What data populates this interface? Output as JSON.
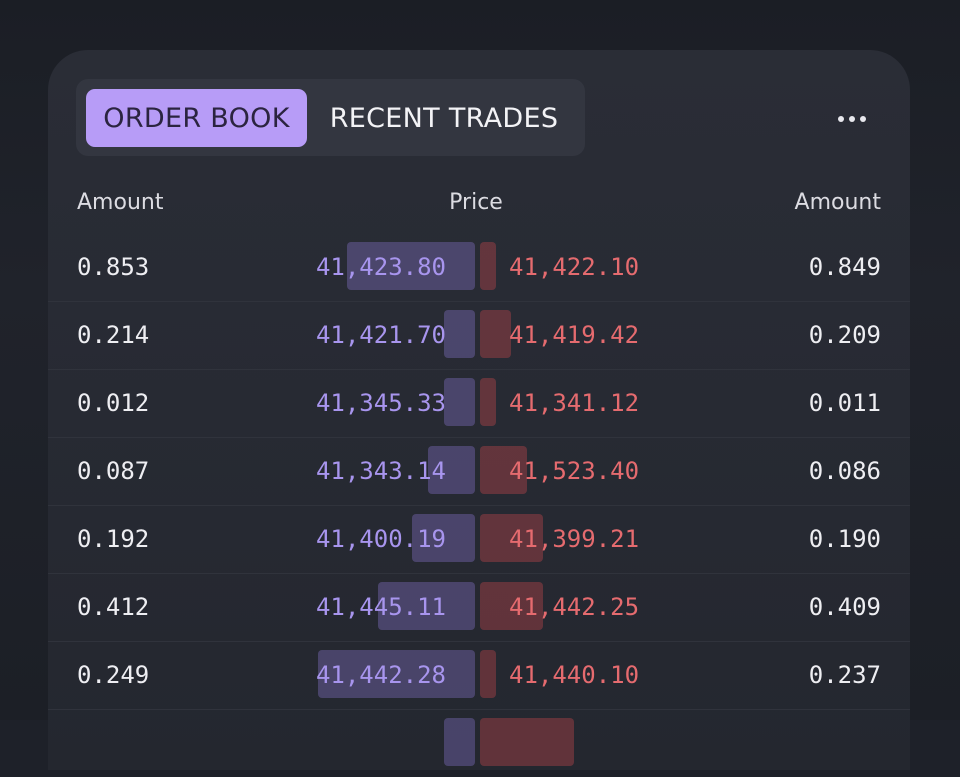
{
  "tabs": {
    "order_book": "ORDER BOOK",
    "recent_trades": "RECENT TRADES"
  },
  "headers": {
    "left": "Amount",
    "mid": "Price",
    "right": "Amount"
  },
  "colors": {
    "accent": "#b79cf7",
    "bid": "#a895ee",
    "ask": "#e56b6f",
    "background": "#1e2129",
    "card": "#2a2d36"
  },
  "rows": [
    {
      "bid_amount": "0.853",
      "bid_price": "41,423.80",
      "ask_price": "41,422.10",
      "ask_amount": "0.849",
      "bid_depth": 0.49,
      "ask_depth": 0.06
    },
    {
      "bid_amount": "0.214",
      "bid_price": "41,421.70",
      "ask_price": "41,419.42",
      "ask_amount": "0.209",
      "bid_depth": 0.12,
      "ask_depth": 0.12
    },
    {
      "bid_amount": "0.012",
      "bid_price": "41,345.33",
      "ask_price": "41,341.12",
      "ask_amount": "0.011",
      "bid_depth": 0.12,
      "ask_depth": 0.06
    },
    {
      "bid_amount": "0.087",
      "bid_price": "41,343.14",
      "ask_price": "41,523.40",
      "ask_amount": "0.086",
      "bid_depth": 0.18,
      "ask_depth": 0.18
    },
    {
      "bid_amount": "0.192",
      "bid_price": "41,400.19",
      "ask_price": "41,399.21",
      "ask_amount": "0.190",
      "bid_depth": 0.24,
      "ask_depth": 0.24
    },
    {
      "bid_amount": "0.412",
      "bid_price": "41,445.11",
      "ask_price": "41,442.25",
      "ask_amount": "0.409",
      "bid_depth": 0.37,
      "ask_depth": 0.24
    },
    {
      "bid_amount": "0.249",
      "bid_price": "41,442.28",
      "ask_price": "41,440.10",
      "ask_amount": "0.237",
      "bid_depth": 0.6,
      "ask_depth": 0.06
    },
    {
      "bid_amount": "",
      "bid_price": "",
      "ask_price": "",
      "ask_amount": "",
      "bid_depth": 0.12,
      "ask_depth": 0.36
    }
  ]
}
